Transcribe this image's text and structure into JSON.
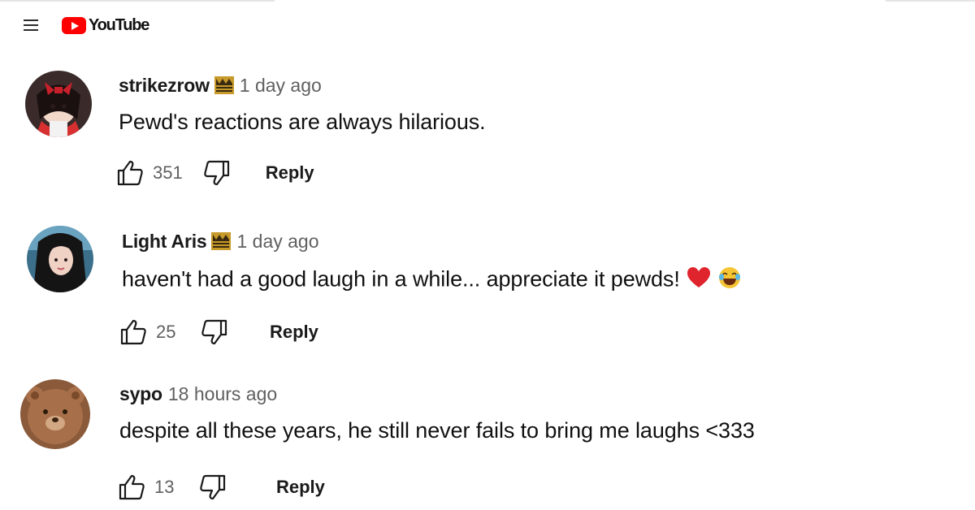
{
  "header": {
    "logo_text": "YouTube",
    "brand_color": "#ff0000"
  },
  "comments": [
    {
      "author": "strikezrow",
      "time": "1 day ago",
      "text": "Pewd's reactions are always hilarious.",
      "likes": "351",
      "reply_label": "Reply",
      "has_badge": true
    },
    {
      "author": "Light Aris",
      "time": "1 day ago",
      "text": "haven't had a good laugh in a while... appreciate it pewds!",
      "likes": "25",
      "reply_label": "Reply",
      "has_badge": true,
      "emojis": [
        "red-heart",
        "face-with-tears-of-joy"
      ]
    },
    {
      "author": "sypo",
      "time": "18 hours ago",
      "text": "despite all these years, he still never fails to bring me laughs <333",
      "likes": "13",
      "reply_label": "Reply",
      "has_badge": false
    }
  ],
  "icons": {
    "menu": "hamburger-menu-icon",
    "like": "thumbs-up-icon",
    "dislike": "thumbs-down-icon",
    "badge": "member-badge-icon"
  }
}
